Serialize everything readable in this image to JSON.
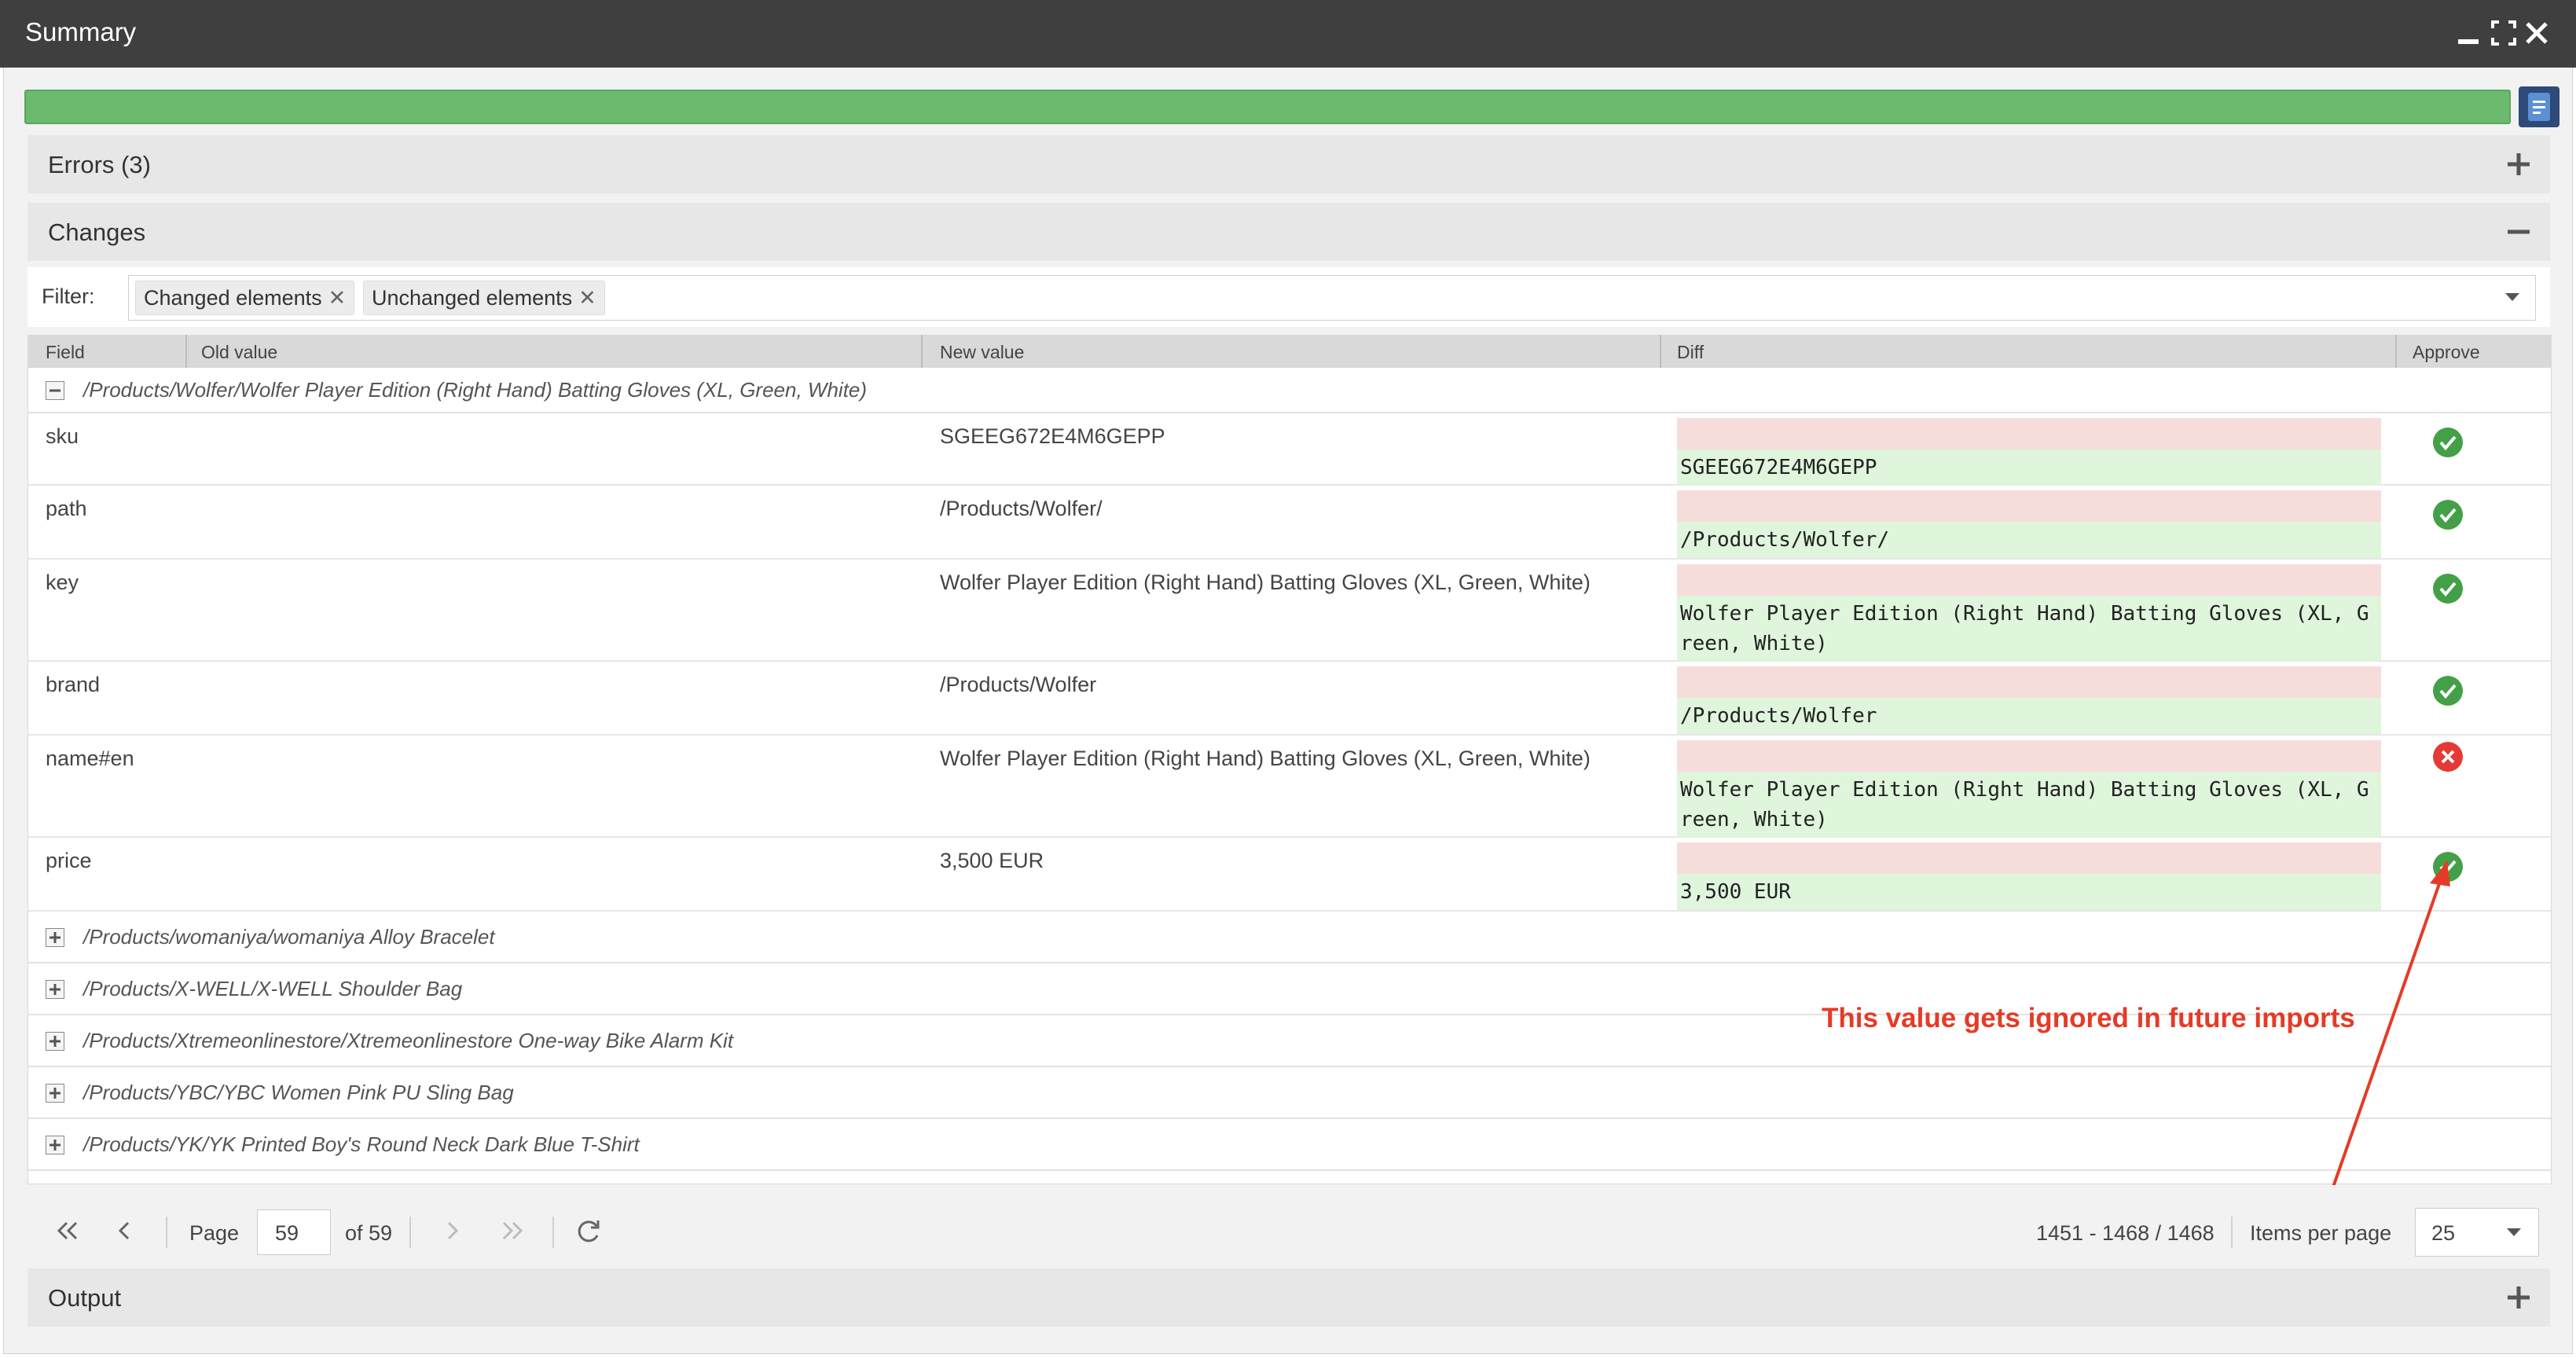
{
  "window": {
    "title": "Summary"
  },
  "panels": {
    "errors": "Errors (3)",
    "changes": "Changes",
    "output": "Output"
  },
  "filter": {
    "label": "Filter:",
    "tags": [
      "Changed elements",
      "Unchanged elements"
    ]
  },
  "grid": {
    "columns": [
      "Field",
      "Old value",
      "New value",
      "Diff",
      "Approve"
    ],
    "expanded_group": "/Products/Wolfer/Wolfer Player Edition (Right Hand) Batting Gloves (XL, Green, White)",
    "rows": [
      {
        "field": "sku",
        "new": "SGEEG672E4M6GEPP",
        "diff": "SGEEG672E4M6GEPP",
        "approved": true
      },
      {
        "field": "path",
        "new": "/Products/Wolfer/",
        "diff": "/Products/Wolfer/",
        "approved": true
      },
      {
        "field": "key",
        "new": "Wolfer Player Edition (Right Hand) Batting Gloves (XL, Green, White)",
        "diff_l1": "Wolfer Player Edition (Right Hand) Batting Gloves (XL, G",
        "diff_l2": "reen, White)",
        "approved": true
      },
      {
        "field": "brand",
        "new": "/Products/Wolfer",
        "diff": "/Products/Wolfer",
        "approved": true
      },
      {
        "field": "name#en",
        "new": "Wolfer Player Edition (Right Hand) Batting Gloves (XL, Green, White)",
        "diff_l1": "Wolfer Player Edition (Right Hand) Batting Gloves (XL, G",
        "diff_l2": "reen, White)",
        "approved": false
      },
      {
        "field": "price",
        "new": "3,500 EUR",
        "diff": "3,500 EUR",
        "approved": true
      }
    ],
    "collapsed_groups": [
      "/Products/womaniya/womaniya Alloy Bracelet",
      "/Products/X-WELL/X-WELL Shoulder Bag",
      "/Products/Xtremeonlinestore/Xtremeonlinestore One-way Bike Alarm Kit",
      "/Products/YBC/YBC Women Pink PU Sling Bag",
      "/Products/YK/YK Printed Boy's Round Neck Dark Blue T-Shirt"
    ]
  },
  "annotation": "This value gets ignored in future imports",
  "pager": {
    "page_label": "Page",
    "page": "59",
    "of": "of 59",
    "range": "1451 - 1468 / 1468",
    "items_label": "Items per page",
    "items": "25"
  },
  "colors": {
    "progress": "#6bba6e",
    "approve": "#43a047",
    "reject": "#e53935",
    "annotation": "#e53b26"
  }
}
